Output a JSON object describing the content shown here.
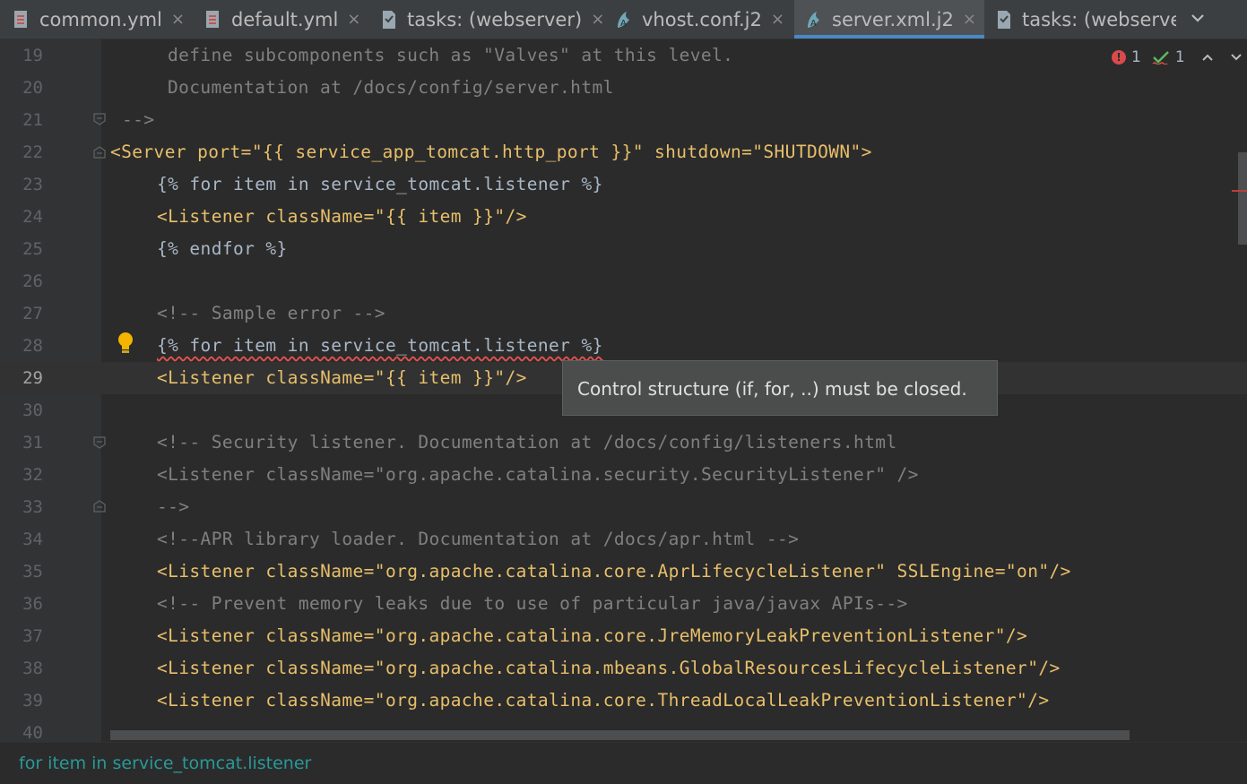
{
  "tabs": [
    {
      "label": "common.yml",
      "icon": "yaml-file-icon",
      "active": false
    },
    {
      "label": "default.yml",
      "icon": "yaml-file-icon",
      "active": false
    },
    {
      "label": "tasks: (webserver)",
      "icon": "tasks-file-icon",
      "active": false
    },
    {
      "label": "vhost.conf.j2",
      "icon": "jinja-template-icon",
      "active": false
    },
    {
      "label": "server.xml.j2",
      "icon": "jinja-template-icon",
      "active": true
    },
    {
      "label": "tasks: (webserve",
      "icon": "tasks-file-icon",
      "active": false
    }
  ],
  "tab_close_glyph": "×",
  "inspection": {
    "errors": "1",
    "weak_warnings": "1"
  },
  "lines": [
    {
      "num": "19",
      "text": "define subcomponents such as \"Valves\" at this level."
    },
    {
      "num": "20",
      "text": "Documentation at /docs/config/server.html"
    },
    {
      "num": "21",
      "text": "-->"
    },
    {
      "num": "22",
      "text": "<Server port=\"{{ service_app_tomcat.http_port }}\" shutdown=\"SHUTDOWN\">"
    },
    {
      "num": "23",
      "text": "{% for item in service_tomcat.listener %}"
    },
    {
      "num": "24",
      "text": "<Listener className=\"{{ item }}\"/>"
    },
    {
      "num": "25",
      "text": "{% endfor %}"
    },
    {
      "num": "26",
      "text": ""
    },
    {
      "num": "27",
      "text": "<!-- Sample error -->"
    },
    {
      "num": "28",
      "text": "{% for item in service_tomcat.listener %}"
    },
    {
      "num": "29",
      "text": "<Listener className=\"{{ item }}\"/>"
    },
    {
      "num": "30",
      "text": ""
    },
    {
      "num": "31",
      "text": "<!-- Security listener. Documentation at /docs/config/listeners.html"
    },
    {
      "num": "32",
      "text": "<Listener className=\"org.apache.catalina.security.SecurityListener\" />"
    },
    {
      "num": "33",
      "text": "-->"
    },
    {
      "num": "34",
      "text": "<!--APR library loader. Documentation at /docs/apr.html -->"
    },
    {
      "num": "35",
      "text": "<Listener className=\"org.apache.catalina.core.AprLifecycleListener\" SSLEngine=\"on\"/>"
    },
    {
      "num": "36",
      "text": "<!-- Prevent memory leaks due to use of particular java/javax APIs-->"
    },
    {
      "num": "37",
      "text": "<Listener className=\"org.apache.catalina.core.JreMemoryLeakPreventionListener\"/>"
    },
    {
      "num": "38",
      "text": "<Listener className=\"org.apache.catalina.mbeans.GlobalResourcesLifecycleListener\"/>"
    },
    {
      "num": "39",
      "text": "<Listener className=\"org.apache.catalina.core.ThreadLocalLeakPreventionListener\"/>"
    },
    {
      "num": "40",
      "text": ""
    }
  ],
  "tooltip": "Control structure (if, for, ..) must be closed.",
  "breadcrumb": "for item in service_tomcat.listener",
  "colors": {
    "editor_bg": "#2b2b2b",
    "gutter_bg": "#313335",
    "tag": "#e8bf6a",
    "string": "#6a8759",
    "comment": "#808080",
    "error_underline": "#e0524f",
    "breadcrumb": "#299999",
    "active_tab_underline": "#4a88c7"
  }
}
